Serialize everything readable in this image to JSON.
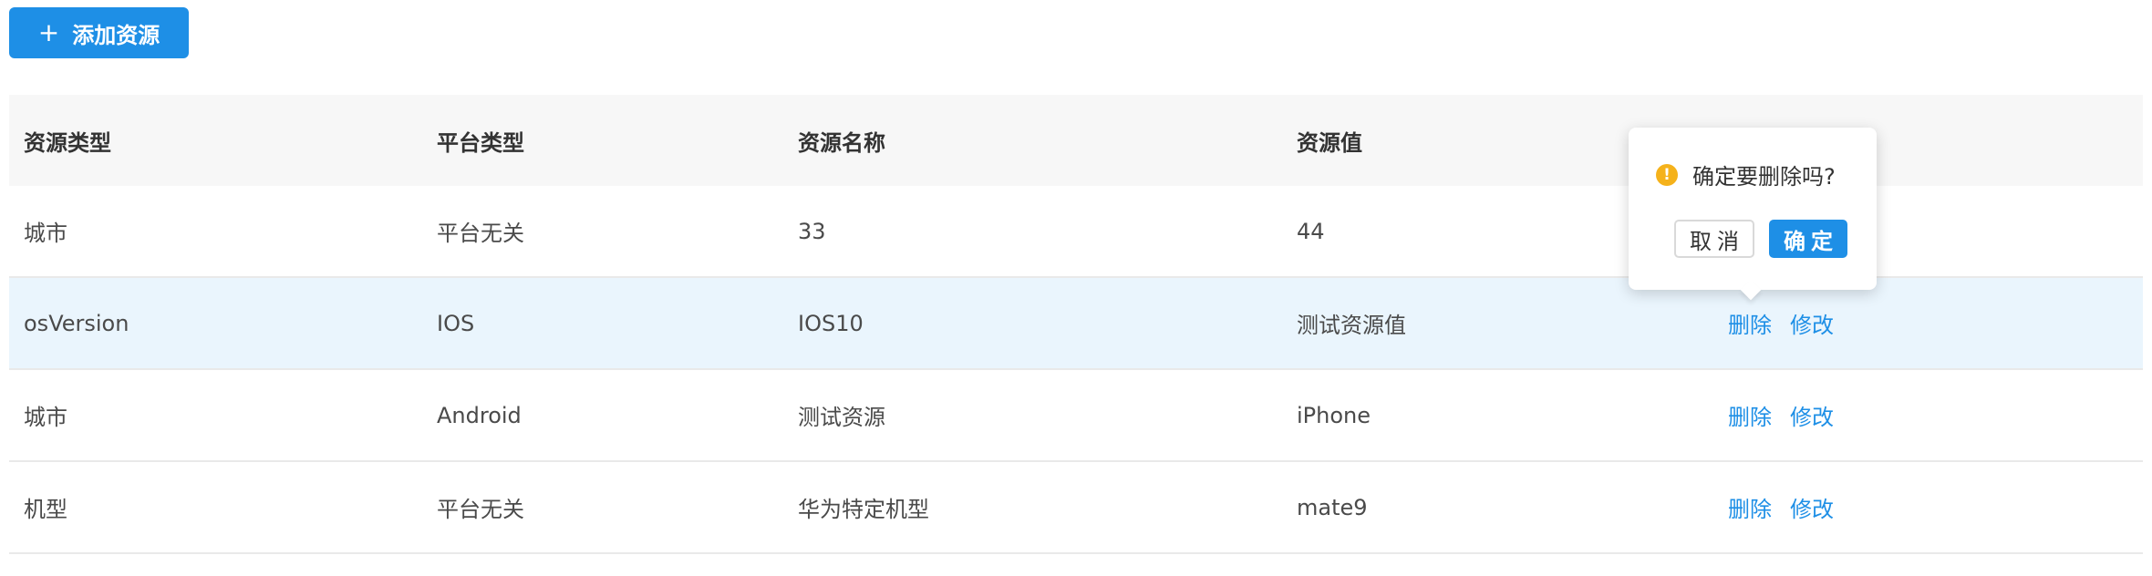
{
  "toolbar": {
    "add_icon": "+",
    "add_label": "添加资源"
  },
  "table": {
    "columns": [
      "资源类型",
      "平台类型",
      "资源名称",
      "资源值",
      ""
    ],
    "rows": [
      {
        "type": "城市",
        "platform": "平台无关",
        "name": "33",
        "value": "44",
        "delete": "",
        "edit": ""
      },
      {
        "type": "osVersion",
        "platform": "IOS",
        "name": "IOS10",
        "value": "测试资源值",
        "delete": "删除",
        "edit": "修改"
      },
      {
        "type": "城市",
        "platform": "Android",
        "name": "测试资源",
        "value": "iPhone",
        "delete": "删除",
        "edit": "修改"
      },
      {
        "type": "机型",
        "platform": "平台无关",
        "name": "华为特定机型",
        "value": "mate9",
        "delete": "删除",
        "edit": "修改"
      }
    ]
  },
  "popconfirm": {
    "icon": "!",
    "message": "确定要删除吗?",
    "cancel_label": "取消",
    "ok_label": "确定"
  },
  "colors": {
    "primary": "#1e8fe6",
    "warning": "#f5b21b",
    "row_highlight": "#eaf5fd",
    "header_bg": "#f7f7f7"
  }
}
